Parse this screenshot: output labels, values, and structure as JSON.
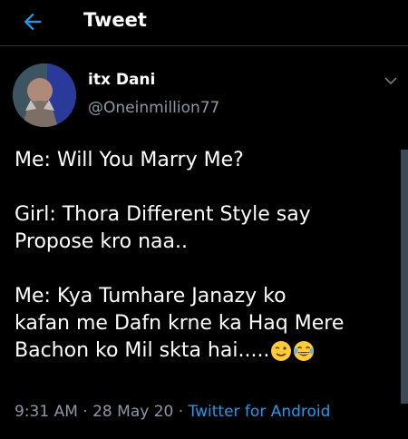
{
  "header": {
    "title": "Tweet",
    "back_icon": "back-arrow-icon",
    "accent": "#1d9bf0"
  },
  "author": {
    "name": "itx Dani",
    "handle": "@Oneinmillion77"
  },
  "tweet": {
    "lines_1": [
      "Me: Will You Marry Me?"
    ],
    "lines_2": [
      "Girl: Thora Different Style say",
      "Propose kro naa.."
    ],
    "lines_3": [
      "Me: Kya Tumhare Janazy ko",
      "kafan me  Dafn krne ka Haq Mere"
    ],
    "last_line": "Bachon ko Mil skta hai.....",
    "emojis": [
      "winking-face-emoji",
      "laughing-tears-emoji"
    ]
  },
  "meta": {
    "time": "9:31 AM",
    "sep1": " · ",
    "date": "28 May 20",
    "sep2": " · ",
    "source": "Twitter for Android"
  }
}
